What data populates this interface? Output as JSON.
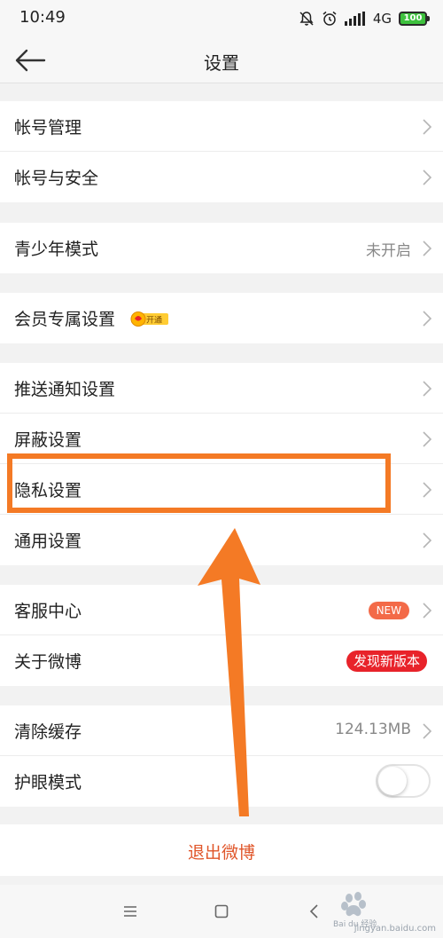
{
  "status_bar": {
    "time": "10:49",
    "network": "4G",
    "battery": "100",
    "icons": [
      "mute-icon",
      "alarm-icon",
      "signal-icon",
      "battery-icon"
    ]
  },
  "nav": {
    "title": "设置",
    "back_icon": "back-arrow-icon"
  },
  "sections": [
    {
      "rows": [
        {
          "label": "帐号管理"
        },
        {
          "label": "帐号与安全"
        }
      ]
    },
    {
      "rows": [
        {
          "label": "青少年模式",
          "value": "未开启"
        }
      ]
    },
    {
      "rows": [
        {
          "label": "会员专属设置",
          "badge": "开通"
        }
      ]
    },
    {
      "rows": [
        {
          "label": "推送通知设置"
        },
        {
          "label": "屏蔽设置"
        },
        {
          "label": "隐私设置"
        },
        {
          "label": "通用设置"
        }
      ]
    },
    {
      "rows": [
        {
          "label": "客服中心",
          "badge": "NEW"
        },
        {
          "label": "关于微博",
          "badge": "发现新版本"
        }
      ]
    },
    {
      "rows": [
        {
          "label": "清除缓存",
          "value": "124.13MB"
        },
        {
          "label": "护眼模式",
          "toggle": false
        }
      ]
    }
  ],
  "logout_label": "退出微博",
  "system_nav": [
    "menu-icon",
    "home-icon",
    "back-icon"
  ],
  "watermark": {
    "text": "Bai du 经验",
    "url": "jingyan.baidu.com"
  },
  "colors": {
    "accent_orange": "#f47a25",
    "logout_text": "#e0562a",
    "new_badge": "#f36a48",
    "update_badge": "#e8232a"
  }
}
